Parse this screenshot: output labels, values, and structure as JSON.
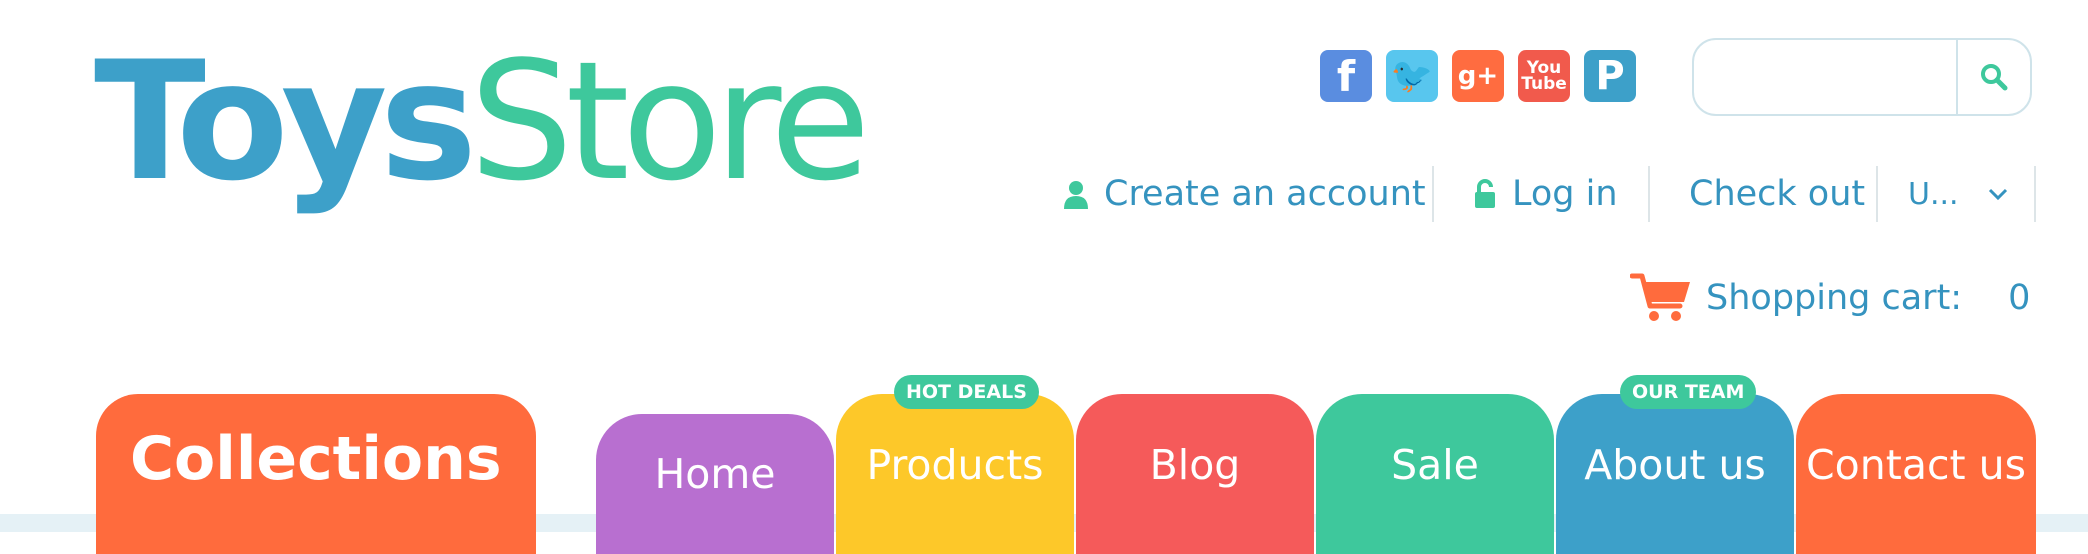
{
  "logo": {
    "part1": "Toys",
    "part2": "Store"
  },
  "social": [
    {
      "name": "facebook",
      "glyph": "f"
    },
    {
      "name": "twitter",
      "glyph": "🐦"
    },
    {
      "name": "google-plus",
      "glyph": "g+"
    },
    {
      "name": "youtube",
      "glyph": "You Tube"
    },
    {
      "name": "pinterest",
      "glyph": "P"
    }
  ],
  "search": {
    "value": "",
    "placeholder": ""
  },
  "account_links": {
    "create": "Create an account",
    "login": "Log in",
    "checkout": "Check out",
    "language": "U..."
  },
  "cart": {
    "label": "Shopping cart:",
    "count": "0"
  },
  "collections": {
    "label": "Collections"
  },
  "nav": {
    "tabs": [
      {
        "label": "Home",
        "color": "#b86fd0",
        "badge": ""
      },
      {
        "label": "Products",
        "color": "#fdc829",
        "badge": "HOT DEALS"
      },
      {
        "label": "Blog",
        "color": "#f55a5a",
        "badge": ""
      },
      {
        "label": "Sale",
        "color": "#3ec89c",
        "badge": ""
      },
      {
        "label": "About us",
        "color": "#3da0c9",
        "badge": "OUR TEAM"
      },
      {
        "label": "Contact us",
        "color": "#ff6b3d",
        "badge": ""
      }
    ]
  },
  "colors": {
    "logo_blue": "#3da0c9",
    "logo_green": "#3ec89c",
    "link_blue": "#3593bf",
    "cart_orange": "#ff6b3d",
    "collections_orange": "#ff6b3d"
  }
}
